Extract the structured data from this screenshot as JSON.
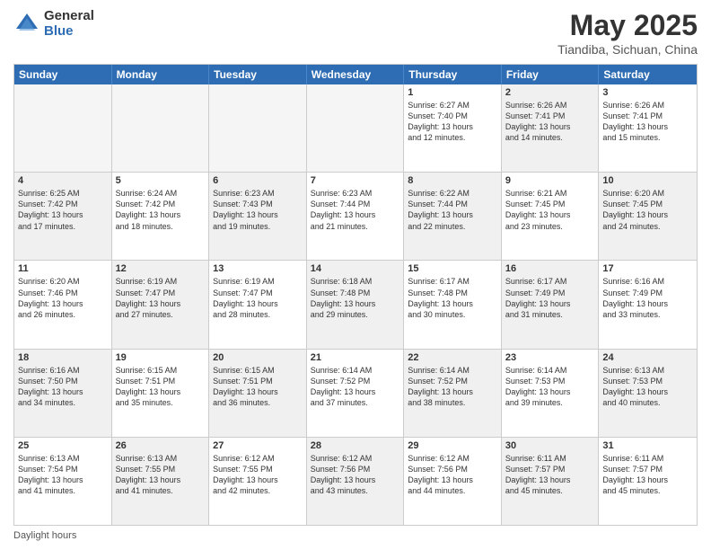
{
  "header": {
    "logo_general": "General",
    "logo_blue": "Blue",
    "title": "May 2025",
    "location": "Tiandiba, Sichuan, China"
  },
  "days_of_week": [
    "Sunday",
    "Monday",
    "Tuesday",
    "Wednesday",
    "Thursday",
    "Friday",
    "Saturday"
  ],
  "footer": "Daylight hours",
  "weeks": [
    [
      {
        "day": "",
        "info": "",
        "shade": "empty"
      },
      {
        "day": "",
        "info": "",
        "shade": "empty"
      },
      {
        "day": "",
        "info": "",
        "shade": "empty"
      },
      {
        "day": "",
        "info": "",
        "shade": "empty"
      },
      {
        "day": "1",
        "info": "Sunrise: 6:27 AM\nSunset: 7:40 PM\nDaylight: 13 hours\nand 12 minutes.",
        "shade": ""
      },
      {
        "day": "2",
        "info": "Sunrise: 6:26 AM\nSunset: 7:41 PM\nDaylight: 13 hours\nand 14 minutes.",
        "shade": "shaded"
      },
      {
        "day": "3",
        "info": "Sunrise: 6:26 AM\nSunset: 7:41 PM\nDaylight: 13 hours\nand 15 minutes.",
        "shade": ""
      }
    ],
    [
      {
        "day": "4",
        "info": "Sunrise: 6:25 AM\nSunset: 7:42 PM\nDaylight: 13 hours\nand 17 minutes.",
        "shade": "shaded"
      },
      {
        "day": "5",
        "info": "Sunrise: 6:24 AM\nSunset: 7:42 PM\nDaylight: 13 hours\nand 18 minutes.",
        "shade": ""
      },
      {
        "day": "6",
        "info": "Sunrise: 6:23 AM\nSunset: 7:43 PM\nDaylight: 13 hours\nand 19 minutes.",
        "shade": "shaded"
      },
      {
        "day": "7",
        "info": "Sunrise: 6:23 AM\nSunset: 7:44 PM\nDaylight: 13 hours\nand 21 minutes.",
        "shade": ""
      },
      {
        "day": "8",
        "info": "Sunrise: 6:22 AM\nSunset: 7:44 PM\nDaylight: 13 hours\nand 22 minutes.",
        "shade": "shaded"
      },
      {
        "day": "9",
        "info": "Sunrise: 6:21 AM\nSunset: 7:45 PM\nDaylight: 13 hours\nand 23 minutes.",
        "shade": ""
      },
      {
        "day": "10",
        "info": "Sunrise: 6:20 AM\nSunset: 7:45 PM\nDaylight: 13 hours\nand 24 minutes.",
        "shade": "shaded"
      }
    ],
    [
      {
        "day": "11",
        "info": "Sunrise: 6:20 AM\nSunset: 7:46 PM\nDaylight: 13 hours\nand 26 minutes.",
        "shade": ""
      },
      {
        "day": "12",
        "info": "Sunrise: 6:19 AM\nSunset: 7:47 PM\nDaylight: 13 hours\nand 27 minutes.",
        "shade": "shaded"
      },
      {
        "day": "13",
        "info": "Sunrise: 6:19 AM\nSunset: 7:47 PM\nDaylight: 13 hours\nand 28 minutes.",
        "shade": ""
      },
      {
        "day": "14",
        "info": "Sunrise: 6:18 AM\nSunset: 7:48 PM\nDaylight: 13 hours\nand 29 minutes.",
        "shade": "shaded"
      },
      {
        "day": "15",
        "info": "Sunrise: 6:17 AM\nSunset: 7:48 PM\nDaylight: 13 hours\nand 30 minutes.",
        "shade": ""
      },
      {
        "day": "16",
        "info": "Sunrise: 6:17 AM\nSunset: 7:49 PM\nDaylight: 13 hours\nand 31 minutes.",
        "shade": "shaded"
      },
      {
        "day": "17",
        "info": "Sunrise: 6:16 AM\nSunset: 7:49 PM\nDaylight: 13 hours\nand 33 minutes.",
        "shade": ""
      }
    ],
    [
      {
        "day": "18",
        "info": "Sunrise: 6:16 AM\nSunset: 7:50 PM\nDaylight: 13 hours\nand 34 minutes.",
        "shade": "shaded"
      },
      {
        "day": "19",
        "info": "Sunrise: 6:15 AM\nSunset: 7:51 PM\nDaylight: 13 hours\nand 35 minutes.",
        "shade": ""
      },
      {
        "day": "20",
        "info": "Sunrise: 6:15 AM\nSunset: 7:51 PM\nDaylight: 13 hours\nand 36 minutes.",
        "shade": "shaded"
      },
      {
        "day": "21",
        "info": "Sunrise: 6:14 AM\nSunset: 7:52 PM\nDaylight: 13 hours\nand 37 minutes.",
        "shade": ""
      },
      {
        "day": "22",
        "info": "Sunrise: 6:14 AM\nSunset: 7:52 PM\nDaylight: 13 hours\nand 38 minutes.",
        "shade": "shaded"
      },
      {
        "day": "23",
        "info": "Sunrise: 6:14 AM\nSunset: 7:53 PM\nDaylight: 13 hours\nand 39 minutes.",
        "shade": ""
      },
      {
        "day": "24",
        "info": "Sunrise: 6:13 AM\nSunset: 7:53 PM\nDaylight: 13 hours\nand 40 minutes.",
        "shade": "shaded"
      }
    ],
    [
      {
        "day": "25",
        "info": "Sunrise: 6:13 AM\nSunset: 7:54 PM\nDaylight: 13 hours\nand 41 minutes.",
        "shade": ""
      },
      {
        "day": "26",
        "info": "Sunrise: 6:13 AM\nSunset: 7:55 PM\nDaylight: 13 hours\nand 41 minutes.",
        "shade": "shaded"
      },
      {
        "day": "27",
        "info": "Sunrise: 6:12 AM\nSunset: 7:55 PM\nDaylight: 13 hours\nand 42 minutes.",
        "shade": ""
      },
      {
        "day": "28",
        "info": "Sunrise: 6:12 AM\nSunset: 7:56 PM\nDaylight: 13 hours\nand 43 minutes.",
        "shade": "shaded"
      },
      {
        "day": "29",
        "info": "Sunrise: 6:12 AM\nSunset: 7:56 PM\nDaylight: 13 hours\nand 44 minutes.",
        "shade": ""
      },
      {
        "day": "30",
        "info": "Sunrise: 6:11 AM\nSunset: 7:57 PM\nDaylight: 13 hours\nand 45 minutes.",
        "shade": "shaded"
      },
      {
        "day": "31",
        "info": "Sunrise: 6:11 AM\nSunset: 7:57 PM\nDaylight: 13 hours\nand 45 minutes.",
        "shade": ""
      }
    ]
  ]
}
